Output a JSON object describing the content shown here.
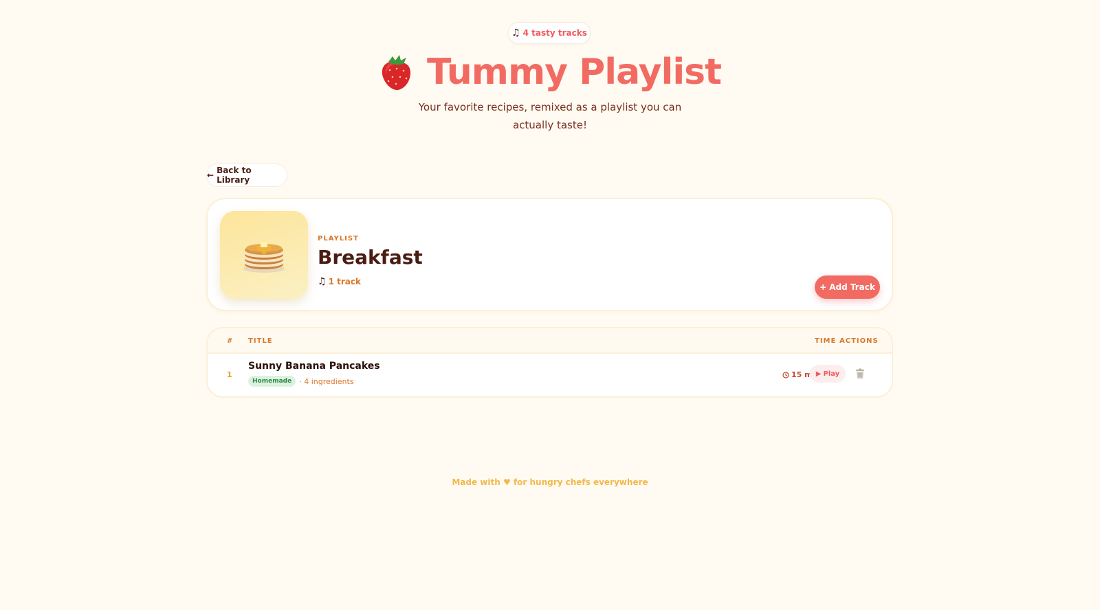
{
  "header": {
    "badge_label": "4 tasty tracks",
    "title": "Tummy Playlist",
    "subtitle": "Your favorite recipes, remixed as a playlist you can actually taste!"
  },
  "nav": {
    "back_label": "Back to Library"
  },
  "playlist": {
    "type_label": "PLAYLIST",
    "name": "Breakfast",
    "track_count": "1 track",
    "add_button_label": "Add Track"
  },
  "tracks": {
    "columns": {
      "number": "#",
      "title": "TITLE",
      "time": "TIME",
      "actions": "ACTIONS"
    },
    "rows": [
      {
        "number": "1",
        "title": "Sunny Banana Pancakes",
        "tag": "Homemade",
        "ingredients": "· 4 ingredients",
        "time": "15 min",
        "play_label": "Play"
      }
    ]
  },
  "footer": {
    "prefix": "Made with",
    "suffix": "for hungry chefs everywhere"
  },
  "colors": {
    "background": "#fffbf2",
    "accent": "#f26b63",
    "orange": "#d9772b",
    "dark": "#4a1d12",
    "tag_bg": "#dcf2df",
    "tag_text": "#2f8a48"
  },
  "icons": {
    "badge": "music-note-icon",
    "title": "strawberry-icon",
    "cover": "pancakes-icon",
    "back": "arrow-left-icon",
    "add": "plus-icon",
    "time": "clock-icon",
    "play": "play-icon",
    "delete": "trash-icon",
    "footer": "heart-icon"
  }
}
